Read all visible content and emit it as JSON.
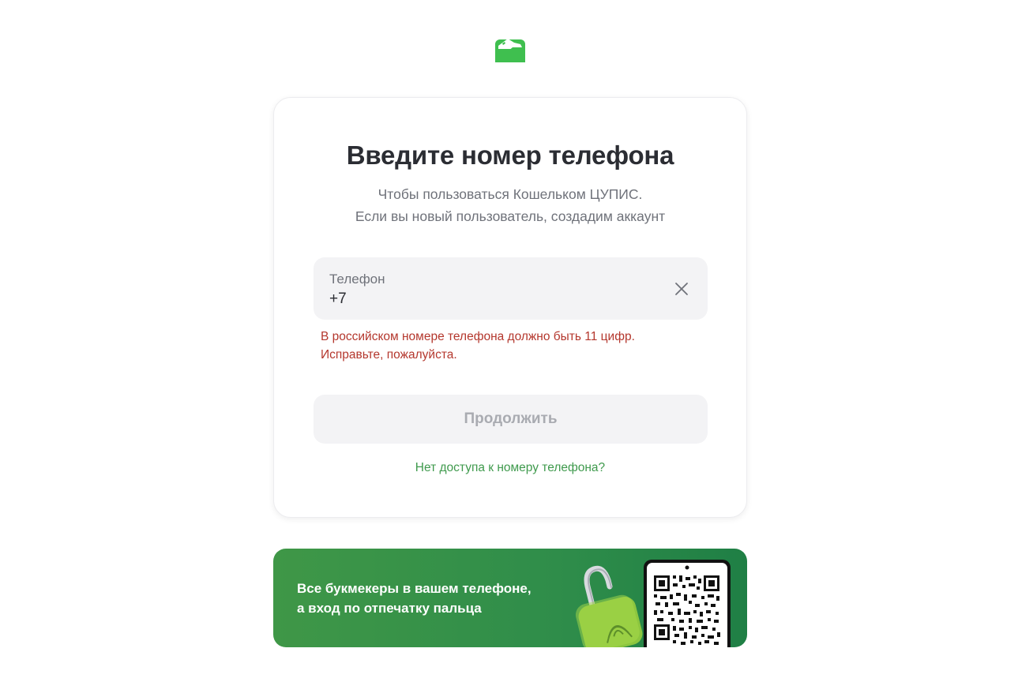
{
  "logo": {
    "icon": "wallet-logo-icon",
    "color": "#3fbf4f"
  },
  "card": {
    "title": "Введите номер телефона",
    "subtitle_line1": "Чтобы пользоваться Кошельком ЦУПИС.",
    "subtitle_line2": "Если вы новый пользователь, создадим аккаунт"
  },
  "phone_field": {
    "label": "Телефон",
    "value": "+7",
    "clear_icon": "close-icon"
  },
  "error": {
    "line1": "В российском номере телефона должно быть 11 цифр.",
    "line2": "Исправьте, пожалуйста.",
    "color": "#b4372d"
  },
  "continue_button": {
    "label": "Продолжить",
    "disabled": true
  },
  "no_access_link": "Нет доступа к номеру телефона?",
  "banner": {
    "line1": "Все букмекеры в вашем телефоне,",
    "line2": "а вход по отпечатку пальца",
    "art_icons": [
      "padlock-fingerprint-icon",
      "phone-qr-code-icon"
    ]
  },
  "colors": {
    "accent_green": "#3f9a4d",
    "banner_green": "#2f8d4a",
    "text_dark": "#2b2d33",
    "text_muted": "#6f727a"
  }
}
